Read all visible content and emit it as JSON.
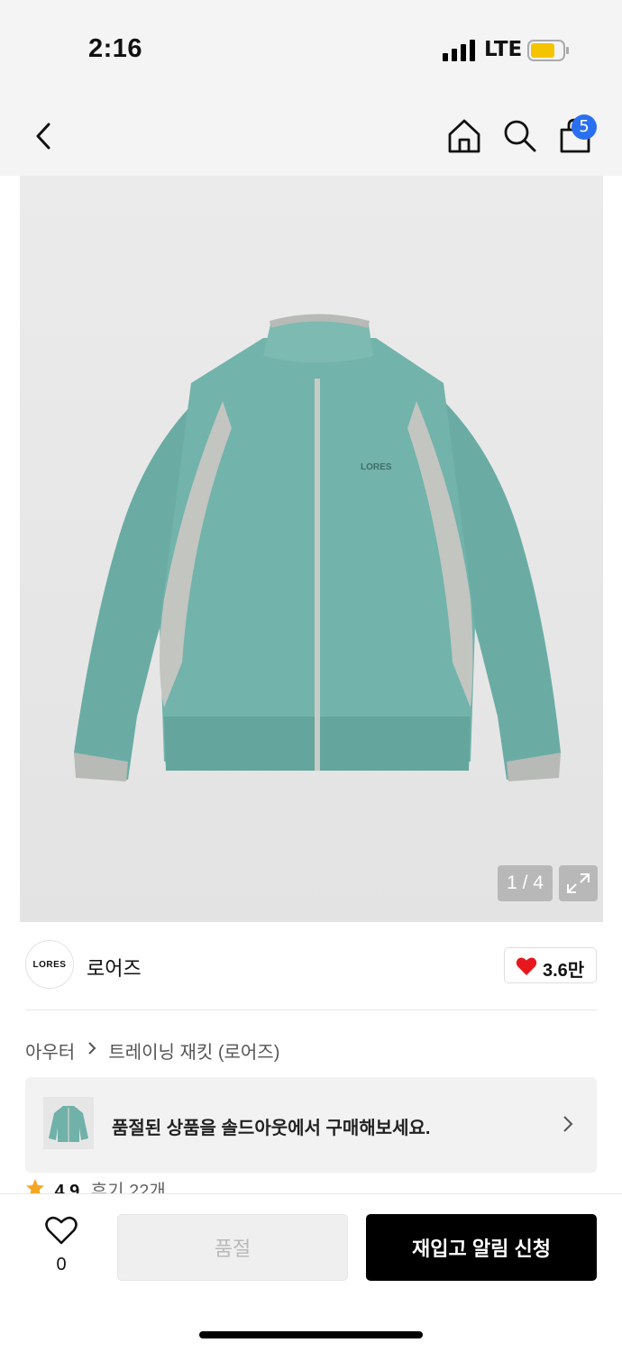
{
  "status_bar": {
    "time": "2:16",
    "network": "LTE",
    "signal_icon": "signal-bars-icon",
    "battery_icon": "battery-icon",
    "battery_color": "#f4c400"
  },
  "nav": {
    "back_icon": "chevron-left-icon",
    "home_icon": "home-icon",
    "search_icon": "search-icon",
    "bag_icon": "shopping-bag-icon",
    "cart_count": "5",
    "badge_color": "#2a6ff0"
  },
  "gallery": {
    "counter": "1 / 4",
    "expand_icon": "expand-icon",
    "jacket_logo_text": "LORES"
  },
  "brand": {
    "logo_text": "LORES",
    "name": "로어즈",
    "like_count": "3.6만",
    "heart_color": "#e8161d"
  },
  "breadcrumb": {
    "category": "아우터",
    "product": "트레이닝 재킷 (로어즈)"
  },
  "promo": {
    "text": "품절된 상품을 솔드아웃에서 구매해보세요."
  },
  "rating": {
    "score": "4.9",
    "reviews": "후기 22개",
    "star_color": "#f5a623"
  },
  "bottom_bar": {
    "wish_count": "0",
    "soldout_label": "품절",
    "restock_label": "재입고 알림 신청"
  }
}
